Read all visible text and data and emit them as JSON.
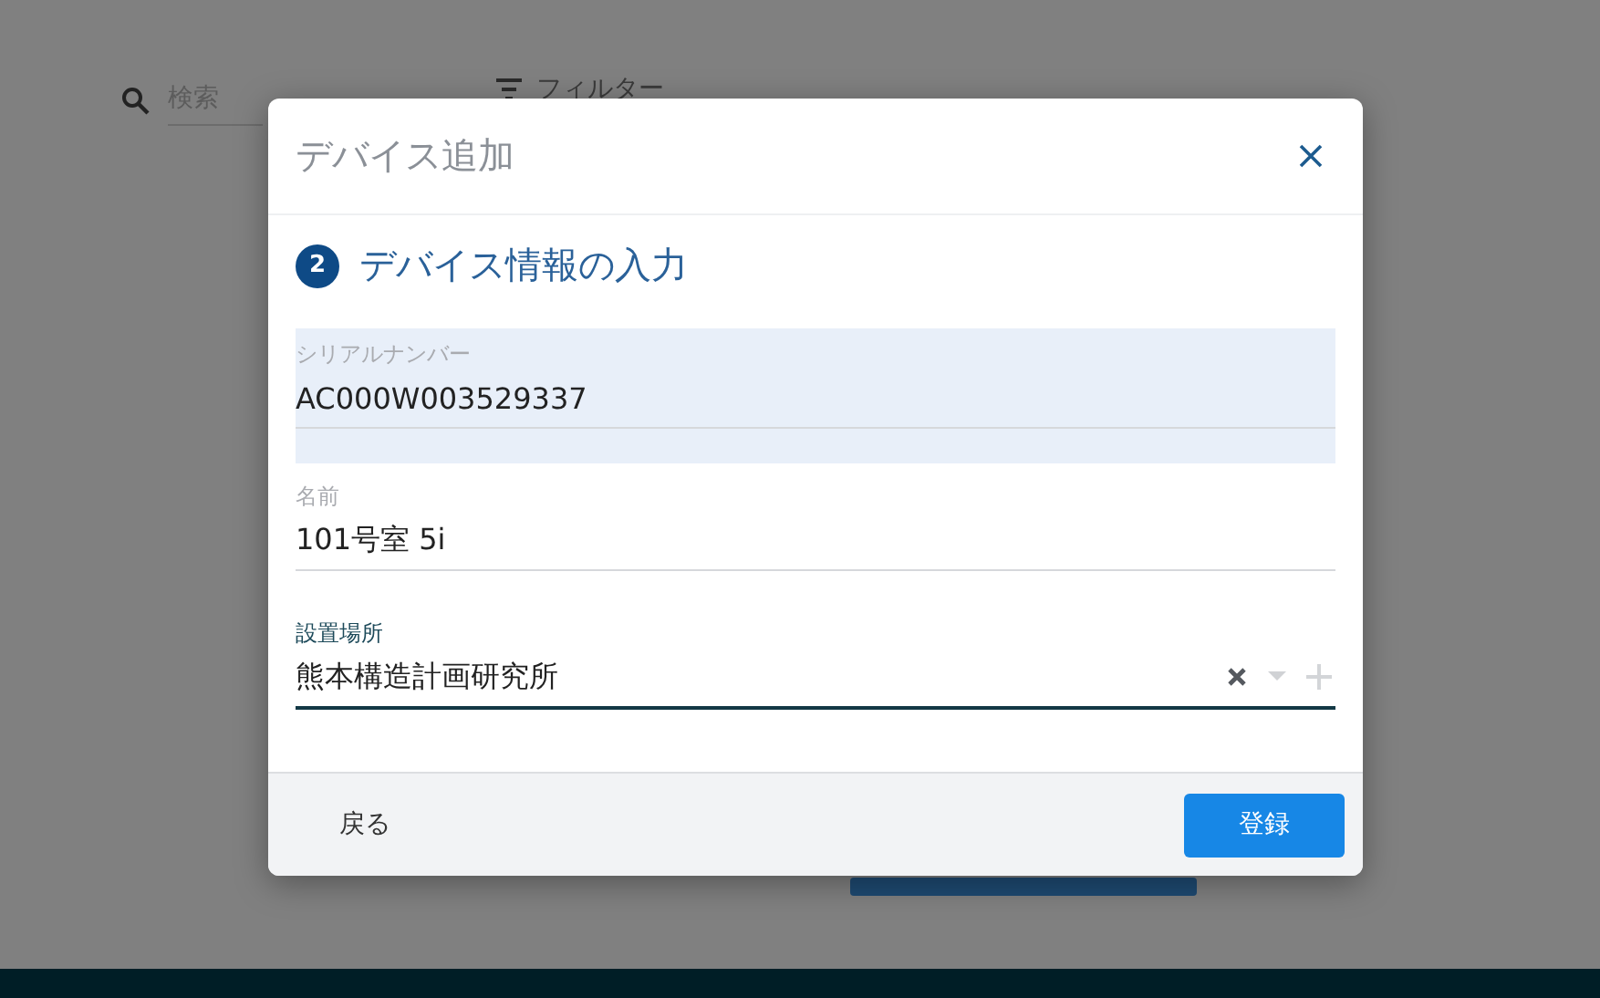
{
  "background": {
    "search": {
      "placeholder": "検索"
    },
    "filter": {
      "label": "フィルター"
    }
  },
  "dialog": {
    "title": "デバイス追加",
    "step": {
      "number": "2",
      "title": "デバイス情報の入力"
    },
    "fields": [
      {
        "kind": "readonly",
        "label": "シリアルナンバー",
        "value": "AC000W003529337",
        "focused": false
      },
      {
        "kind": "text",
        "label": "名前",
        "value": "101号室 5i",
        "focused": false
      },
      {
        "kind": "select",
        "label": "設置場所",
        "value": "熊本構造計画研究所",
        "focused": true
      }
    ],
    "buttons": [
      {
        "kind": "text",
        "label": "戻る"
      },
      {
        "kind": "primary",
        "label": "登録"
      }
    ]
  }
}
